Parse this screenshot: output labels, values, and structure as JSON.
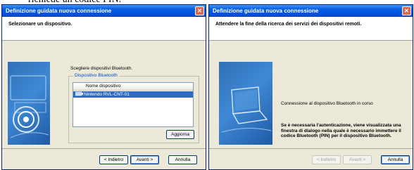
{
  "top_text": "richiede un codice PIN.",
  "window1": {
    "title": "Definizione guidata nuova connessione",
    "header": "Selezionare un dispositivo.",
    "prompt": "Scegliere dispositivi Bluetooth.",
    "group_title": "Dispositivo Bluetooth",
    "list_column": "Nome dispositivo",
    "devices": [
      "Nintendo RVL-CNT-01"
    ],
    "refresh_label": "Aggiorna",
    "back_label": "< Indietro",
    "next_label": "Avanti >",
    "cancel_label": "Annulla"
  },
  "window2": {
    "title": "Definizione guidata nuova connessione",
    "header": "Attendere la fine della ricerca dei servizi dei dispositivi remoti.",
    "status": "Connessione al dispositivo Bluetooth in corso",
    "info": "Se è necessaria l'autenticazione, viene visualizzata una finestra di dialogo nella quale è necessario immettere il codice Bluetooth (PIN) per il dispositivo Bluetooth.",
    "back_label": "< Indietro",
    "next_label": "Avanti >",
    "cancel_label": "Annulla"
  },
  "colors": {
    "titlebar": "#0054e3",
    "selection": "#316ac5",
    "dialog_bg": "#ece9d8"
  }
}
